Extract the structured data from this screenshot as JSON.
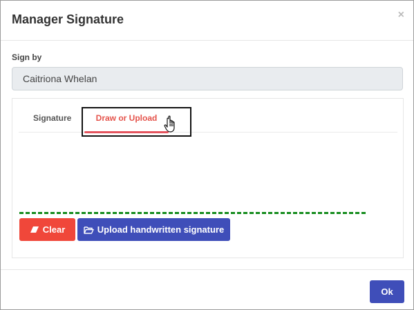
{
  "modal": {
    "title": "Manager Signature",
    "close": "×"
  },
  "sign_by": {
    "label": "Sign by",
    "value": "Caitriona Whelan"
  },
  "tabs": [
    {
      "label": "Signature",
      "active": false
    },
    {
      "label": "Draw or Upload",
      "active": true
    }
  ],
  "buttons": {
    "clear": "Clear",
    "upload": "Upload handwritten signature",
    "ok": "Ok"
  },
  "icons": {
    "clear": "eraser-icon",
    "upload": "folder-open-icon",
    "pointer": "hand-pointer-icon"
  },
  "colors": {
    "accent_tab": "#e5535d",
    "clear_button": "#f0473a",
    "primary_button": "#3f4eb9",
    "signature_line": "#138b1b"
  }
}
